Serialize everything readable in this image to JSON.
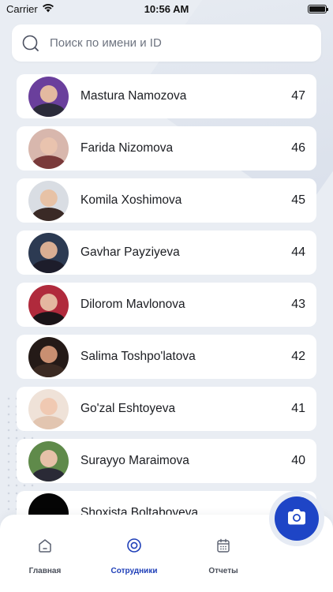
{
  "status_bar": {
    "carrier": "Carrier",
    "time": "10:56 AM",
    "wifi_icon": "wifi-icon",
    "battery_icon": "battery-icon",
    "battery_level": 1.0
  },
  "search": {
    "placeholder": "Поиск по имени и ID",
    "value": "",
    "icon": "search-icon"
  },
  "employees": [
    {
      "name": "Mastura Namozova",
      "id": "47"
    },
    {
      "name": "Farida Nizomova",
      "id": "46"
    },
    {
      "name": "Komila Xoshimova",
      "id": "45"
    },
    {
      "name": "Gavhar Payziyeva",
      "id": "44"
    },
    {
      "name": "Dilorom Mavlonova",
      "id": "43"
    },
    {
      "name": "Salima Toshpo'latova",
      "id": "42"
    },
    {
      "name": "Go'zal Eshtoyeva",
      "id": "41"
    },
    {
      "name": "Surayyo Maraimova",
      "id": "40"
    },
    {
      "name": "Shoxista Boltaboyeva",
      "id": ""
    }
  ],
  "tabbar": {
    "tabs": [
      {
        "label": "Главная",
        "icon": "home-icon",
        "active": false
      },
      {
        "label": "Сотрудники",
        "icon": "employees-icon",
        "active": true
      },
      {
        "label": "Отчеты",
        "icon": "calendar-icon",
        "active": false
      }
    ]
  },
  "fab": {
    "icon": "camera-icon"
  },
  "colors": {
    "accent": "#1e45c6",
    "active_tab": "#1f3fb8",
    "background": "#e9edf3",
    "card": "#ffffff"
  }
}
